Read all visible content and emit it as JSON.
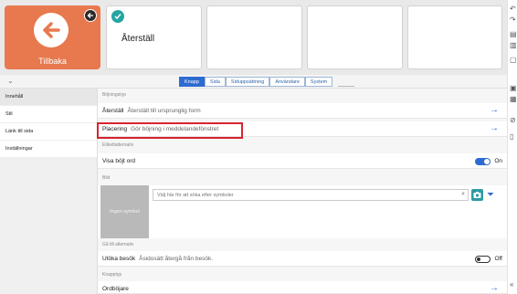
{
  "top": {
    "back_button": {
      "label": "Tillbaka",
      "icon": "arrow-left-icon",
      "corner_icon": "back-mini-icon"
    },
    "selected_cell": {
      "title": "Återställ",
      "icon": "check-icon"
    }
  },
  "subheader": {
    "collapse_icon": "double-chevron-down-icon",
    "tabs": [
      {
        "label": "Knapp",
        "active": true
      },
      {
        "label": "Sida",
        "active": false
      },
      {
        "label": "Siduppsättning",
        "active": false
      },
      {
        "label": "Användare",
        "active": false
      },
      {
        "label": "System",
        "active": false
      }
    ]
  },
  "sidebar": {
    "items": [
      {
        "label": "Innehåll",
        "active": true
      },
      {
        "label": "Stil",
        "active": false
      },
      {
        "label": "Länk till sida",
        "active": false
      },
      {
        "label": "Inställningar",
        "active": false
      }
    ]
  },
  "main": {
    "sections": {
      "inflection_type": "Böjningstyp",
      "label_options": "Etikettalternativ",
      "picture": "Bild",
      "goto_options": "Gå till alternativ",
      "button_type": "Knapptyp"
    },
    "rows": {
      "reset": {
        "label": "Återställ",
        "desc": "Återställ till ursprunglig form"
      },
      "placement": {
        "label": "Placering",
        "desc": "Gör böjning i meddelandefönstret"
      },
      "show_word": {
        "label": "Visa böjt ord",
        "state": "On"
      },
      "extend_visit": {
        "label": "Utöka besök",
        "desc": "Åsidosätt återgå från besök.",
        "state": "Off"
      },
      "button_type": {
        "label": "Ordböjare"
      }
    },
    "picture": {
      "no_symbol": "Ingen symbol",
      "search_placeholder": "Välj här för att söka efter symboler"
    }
  },
  "colors": {
    "back_button": "#e8784e",
    "accent": "#2e6bd1",
    "check": "#23a6a2",
    "highlight": "#d9232f"
  }
}
